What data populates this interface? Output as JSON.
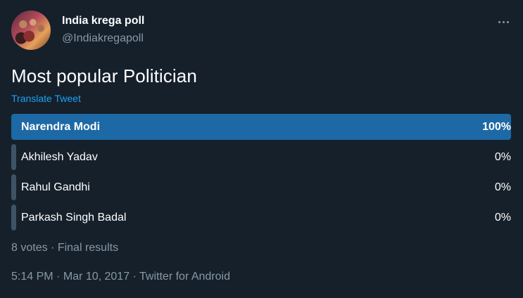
{
  "author": {
    "display_name": "India krega poll",
    "handle": "@Indiakregapoll"
  },
  "tweet": {
    "text": "Most popular Politician",
    "translate_label": "Translate Tweet"
  },
  "poll": {
    "options": [
      {
        "label": "Narendra Modi",
        "percent_text": "100%",
        "fraction": 1.0,
        "winner": true
      },
      {
        "label": "Akhilesh Yadav",
        "percent_text": "0%",
        "fraction": 0.0,
        "winner": false
      },
      {
        "label": "Rahul Gandhi",
        "percent_text": "0%",
        "fraction": 0.0,
        "winner": false
      },
      {
        "label": "Parkash Singh Badal",
        "percent_text": "0%",
        "fraction": 0.0,
        "winner": false
      }
    ],
    "votes_text": "8 votes",
    "separator": " · ",
    "status_text": "Final results"
  },
  "meta": {
    "time": "5:14 PM",
    "date": "Mar 10, 2017",
    "source": "Twitter for Android",
    "separator": " · "
  },
  "colors": {
    "background": "#15202b",
    "winner_bar": "#1d69a5",
    "other_bar": "#3d5466",
    "link": "#1da1f2",
    "muted": "#8899a6"
  },
  "icons": {
    "more": "more-horizontal-icon"
  }
}
